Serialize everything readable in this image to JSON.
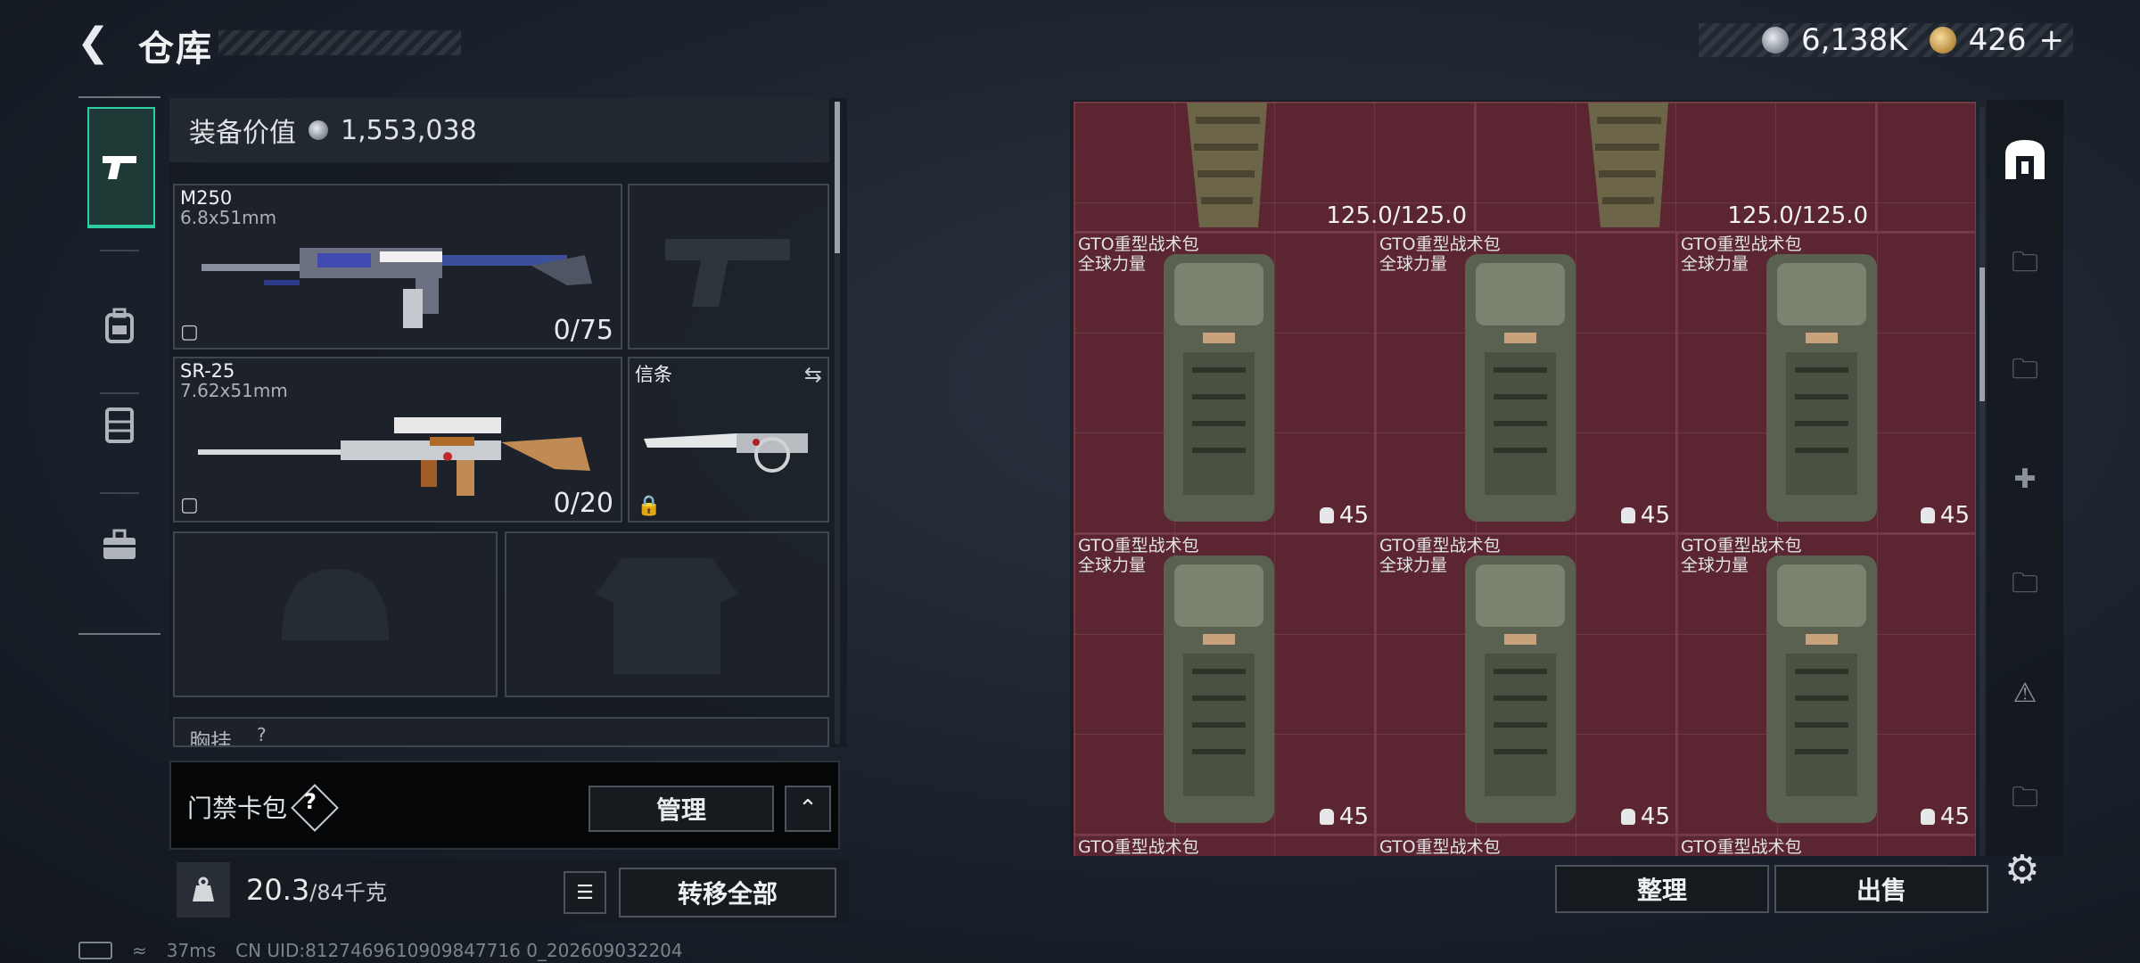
{
  "header": {
    "title": "仓库",
    "silver": "6,138K",
    "gold": "426",
    "gold_plus": "+"
  },
  "left_nav": {
    "items": [
      "pistol-icon",
      "backpack-icon",
      "vest-icon",
      "toolbox-icon"
    ],
    "active": 0
  },
  "equipment": {
    "value_label": "装备价值",
    "value": "1,553,038",
    "primary": {
      "name": "M250",
      "caliber": "6.8x51mm",
      "ammo": "0/75"
    },
    "secondary": {
      "name": "SR-25",
      "caliber": "7.62x51mm",
      "ammo": "0/20"
    },
    "melee": {
      "name": "信条"
    },
    "chest_label": "胸挂",
    "chest_help": "?"
  },
  "keybag": {
    "label": "门禁卡包",
    "help": "?",
    "manage": "管理"
  },
  "weight": {
    "current": "20.3",
    "max": "/84千克"
  },
  "transfer_all": "转移全部",
  "status": {
    "ping": "37ms",
    "uid": "CN UID:8127469610909847716 0_202609032204"
  },
  "storage": {
    "top_durability": [
      "125.0/125.0",
      "125.0/125.0"
    ],
    "items": [
      {
        "name": "GTO重型战术包",
        "sub": "全球力量",
        "capacity": "45"
      },
      {
        "name": "GTO重型战术包",
        "sub": "全球力量",
        "capacity": "45"
      },
      {
        "name": "GTO重型战术包",
        "sub": "全球力量",
        "capacity": "45"
      },
      {
        "name": "GTO重型战术包",
        "sub": "全球力量",
        "capacity": "45"
      },
      {
        "name": "GTO重型战术包",
        "sub": "全球力量",
        "capacity": "45"
      },
      {
        "name": "GTO重型战术包",
        "sub": "全球力量",
        "capacity": "45"
      }
    ],
    "peek_items": [
      "GTO重型战术包",
      "GTO重型战术包",
      "GTO重型战术包"
    ]
  },
  "buttons": {
    "sort": "整理",
    "sell": "出售"
  },
  "colors": {
    "accent": "#2ad0a4",
    "cell": "#5b2531"
  }
}
